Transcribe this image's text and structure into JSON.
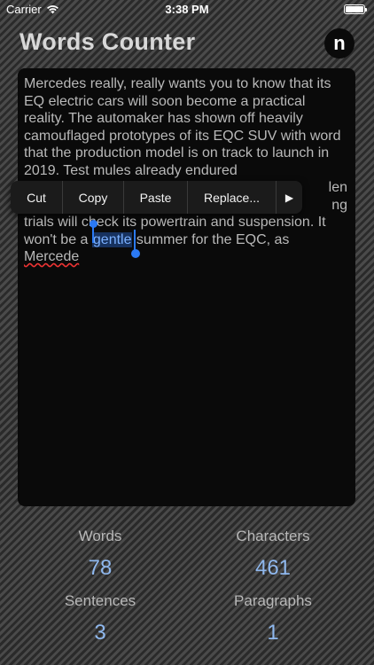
{
  "status_bar": {
    "carrier": "Carrier",
    "time": "3:38 PM"
  },
  "header": {
    "title": "Words Counter",
    "logo_letter": "n"
  },
  "editor": {
    "text_before": "Mercedes really, really wants you to know that its EQ electric cars will soon become a practical reality. The automaker has shown off heavily camouflaged prototypes of its EQC SUV with word that the production model is on track to launch in 2019. Test mules already endured",
    "text_hidden_line_end": "len",
    "text_hidden_line_end2": "ng",
    "text_middle": "trials will check its powertrain and suspension. It won't be a ",
    "selected_word": "gentle",
    "text_after": " summer for the EQC, as ",
    "misspelled_word": "Mercede"
  },
  "edit_menu": {
    "cut": "Cut",
    "copy": "Copy",
    "paste": "Paste",
    "replace": "Replace...",
    "more": "▶"
  },
  "stats": {
    "words_label": "Words",
    "words_value": "78",
    "characters_label": "Characters",
    "characters_value": "461",
    "sentences_label": "Sentences",
    "sentences_value": "3",
    "paragraphs_label": "Paragraphs",
    "paragraphs_value": "1"
  }
}
